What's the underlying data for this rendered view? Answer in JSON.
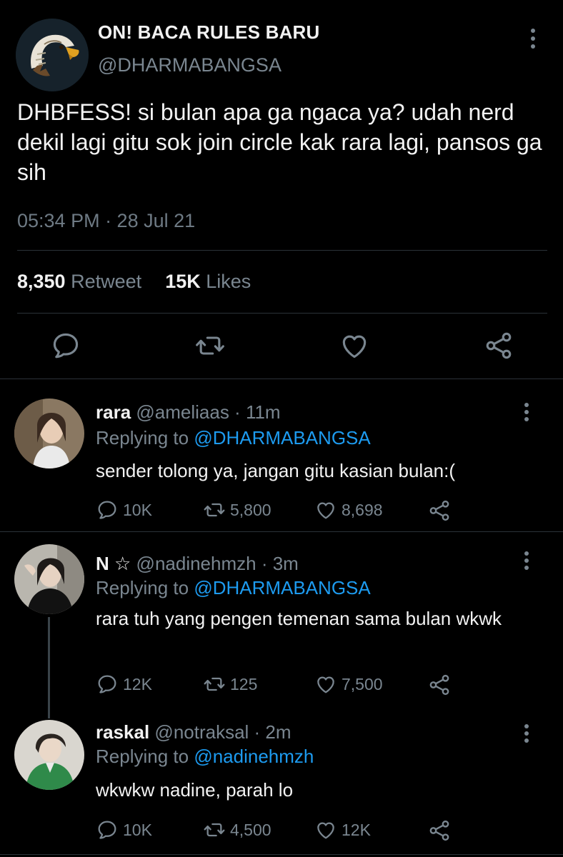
{
  "main_tweet": {
    "display_name": "ON! BACA RULES BARU",
    "handle": "@DHARMABANGSA",
    "text": "DHBFESS! si bulan apa ga ngaca ya? udah nerd dekil lagi gitu sok join circle kak rara lagi, pansos ga sih",
    "timestamp": "05:34 PM · 28 Jul 21",
    "retweet_count": "8,350",
    "retweet_label": "Retweet",
    "likes_count": "15K",
    "likes_label": "Likes",
    "actions": [
      "reply-icon",
      "retweet-icon",
      "like-icon",
      "share-icon"
    ]
  },
  "replies": [
    {
      "name": "rara",
      "handle_time": "@ameliaas · 11m",
      "replying_label": "Replying to",
      "replying_to": "@DHARMABANGSA",
      "text": "sender tolong ya, jangan gitu  kasian bulan:(",
      "reply_count": "10K",
      "retweet_count": "5,800",
      "like_count": "8,698"
    },
    {
      "name": "N ☆",
      "handle_time": "@nadinehmzh · 3m",
      "replying_label": "Replying to",
      "replying_to": "@DHARMABANGSA",
      "text": "rara tuh yang pengen temenan sama bulan wkwk",
      "reply_count": "12K",
      "retweet_count": "125",
      "like_count": "7,500"
    },
    {
      "name": "raskal",
      "handle_time": "@notraksal · 2m",
      "replying_label": "Replying to",
      "replying_to": "@nadinehmzh",
      "text": "wkwkw nadine, parah lo",
      "reply_count": "10K",
      "retweet_count": "4,500",
      "like_count": "12K"
    }
  ],
  "colors": {
    "background": "#000000",
    "text": "#f2f2f2",
    "muted": "#7a8690",
    "link": "#1d9bf0",
    "divider": "#2b3238"
  }
}
